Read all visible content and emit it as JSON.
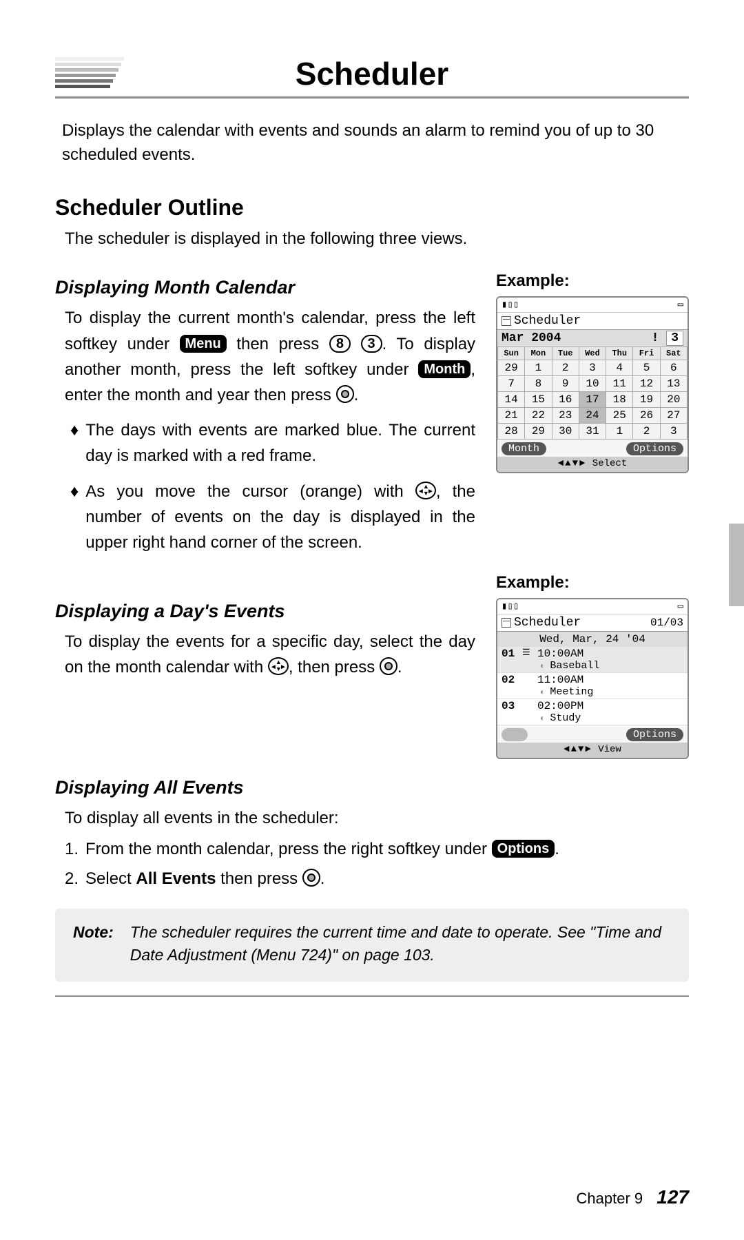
{
  "pageTitle": "Scheduler",
  "intro": "Displays the calendar with events and sounds an alarm to remind you of up to 30 scheduled events.",
  "section1": {
    "heading": "Scheduler Outline",
    "body": "The scheduler is displayed in the following three views."
  },
  "monthSection": {
    "heading": "Displaying Month Calendar",
    "para_a": "To display the current month's calendar, press the left softkey under ",
    "key_menu": "Menu",
    "para_b": " then press ",
    "key_8": "8",
    "key_3": "3",
    "para_c": ". To display another month, press the left softkey under ",
    "key_month": "Month",
    "para_d": ", enter the month and year then press ",
    "para_e": ".",
    "bullet1": "The days with events are marked blue. The current day is marked with a red frame.",
    "bullet2_a": "As you move the cursor (orange) with ",
    "bullet2_b": ", the number of events on the day is displayed in the upper right hand corner of the screen."
  },
  "daySection": {
    "heading": "Displaying a Day's Events",
    "para_a": "To display the events for a specific day, select the day on the month calendar with ",
    "para_b": ", then press ",
    "para_c": "."
  },
  "allSection": {
    "heading": "Displaying All Events",
    "intro": "To display all events in the scheduler:",
    "step1_a": "From the month calendar, press the right softkey under ",
    "key_options": "Options",
    "step1_b": ".",
    "step2_a": "Select ",
    "step2_bold": "All Events",
    "step2_b": " then press ",
    "step2_c": "."
  },
  "note": {
    "label": "Note:",
    "text": "The scheduler requires the current time and date to operate. See \"Time and Date Adjustment (Menu 724)\" on page 103."
  },
  "exampleLabel": "Example:",
  "shot1": {
    "title": "Scheduler",
    "monthLabel": "Mar 2004",
    "alert": "!",
    "countBox": "3",
    "dow": [
      "Sun",
      "Mon",
      "Tue",
      "Wed",
      "Thu",
      "Fri",
      "Sat"
    ],
    "rows": [
      [
        "29",
        "1",
        "2",
        "3",
        "4",
        "5",
        "6"
      ],
      [
        "7",
        "8",
        "9",
        "10",
        "11",
        "12",
        "13"
      ],
      [
        "14",
        "15",
        "16",
        "17",
        "18",
        "19",
        "20"
      ],
      [
        "21",
        "22",
        "23",
        "24",
        "25",
        "26",
        "27"
      ],
      [
        "28",
        "29",
        "30",
        "31",
        "1",
        "2",
        "3"
      ]
    ],
    "selected": "17",
    "softLeft": "Month",
    "softRight": "Options",
    "hint": "Select"
  },
  "shot2": {
    "title": "Scheduler",
    "count": "01/03",
    "date": "Wed, Mar, 24 '04",
    "events": [
      {
        "idx": "01",
        "time": "10:00AM",
        "sub": "Baseball",
        "sel": true
      },
      {
        "idx": "02",
        "time": "11:00AM",
        "sub": "Meeting",
        "sel": false
      },
      {
        "idx": "03",
        "time": "02:00PM",
        "sub": "Study",
        "sel": false
      }
    ],
    "softRight": "Options",
    "hint": "View"
  },
  "footer": {
    "chapter": "Chapter 9",
    "page": "127"
  }
}
